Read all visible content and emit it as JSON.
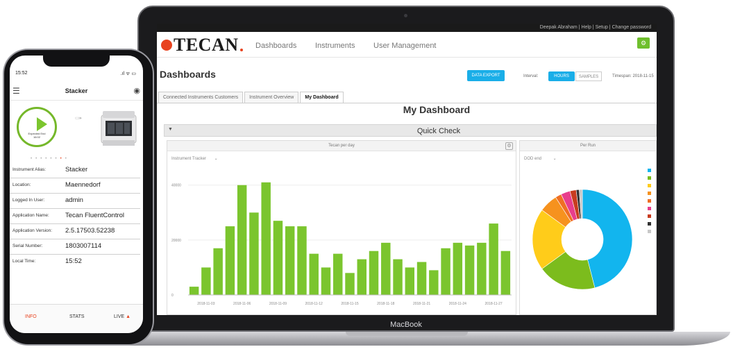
{
  "laptop": {
    "top_links": "Deepak Abraham | Help | Setup | Change password",
    "logo": "TECAN",
    "nav": [
      "Dashboards",
      "Instruments",
      "User Management"
    ],
    "page_title": "Dashboards",
    "buttons": {
      "data_export": "DATA EXPORT",
      "toggle_on": "HOURS",
      "toggle_off": "SAMPLES"
    },
    "interval_label": "Interval:",
    "timespan_label": "Timespan:  2018-11-15",
    "tabs": [
      "Connected Instruments Customers",
      "Instrument Overview",
      "My Dashboard"
    ],
    "dashboard_title": "My Dashboard",
    "quick_check": "Quick Check",
    "bar_panel": {
      "title": "Tecan per day",
      "filter": "Instrument Tracker",
      "y_ticks": [
        "40000",
        "20000",
        "0"
      ],
      "x_ticks": [
        "2018-11-03",
        "2018-11-06",
        "2018-11-09",
        "2018-11-12",
        "2018-11-15",
        "2018-11-18",
        "2018-11-21",
        "2018-11-24",
        "2018-11-27"
      ]
    },
    "pie_panel": {
      "title": "Per Run",
      "filter": "DOD end"
    }
  },
  "chart_data": [
    {
      "type": "bar",
      "title": "Tecan per day",
      "xlabel": "",
      "ylabel": "",
      "ylim": [
        0,
        46000
      ],
      "values": [
        3000,
        10000,
        17000,
        25000,
        40000,
        30000,
        41000,
        27000,
        25000,
        25000,
        15000,
        10000,
        15000,
        8000,
        13000,
        16000,
        19000,
        13000,
        10000,
        12000,
        9000,
        17000,
        19000,
        18000,
        19000,
        26000,
        16000
      ]
    },
    {
      "type": "pie",
      "title": "Per Run",
      "values": [
        46,
        19,
        20,
        6,
        2,
        3,
        2,
        1,
        1
      ],
      "colors": [
        "#12b5ee",
        "#7cbc1d",
        "#ffcc1a",
        "#f6921e",
        "#ef6f24",
        "#e83e8c",
        "#c83c1f",
        "#333333",
        "#c8c8c8"
      ]
    }
  ],
  "phone": {
    "time": "15:52",
    "status": ".ıl ᯤ ▭",
    "title": "Stacker",
    "play_text": "Expected End",
    "play_time": "16:02",
    "fields": [
      {
        "k": "Instrument Alias:",
        "v": "Stacker"
      },
      {
        "k": "Location:",
        "v": "Maennedorf"
      },
      {
        "k": "Logged In User:",
        "v": "admin"
      },
      {
        "k": "Application Name:",
        "v": "Tecan FluentControl"
      },
      {
        "k": "Application Version:",
        "v": "2.5.17503.52238"
      },
      {
        "k": "Serial Number:",
        "v": "1803007114"
      },
      {
        "k": "Local Time:",
        "v": "15:52"
      }
    ],
    "bottom": [
      "INFO",
      "STATS",
      "LIVE"
    ],
    "colors": {
      "accent": "#e8431f",
      "green": "#75b82a"
    }
  },
  "macbook_label": "MacBook"
}
